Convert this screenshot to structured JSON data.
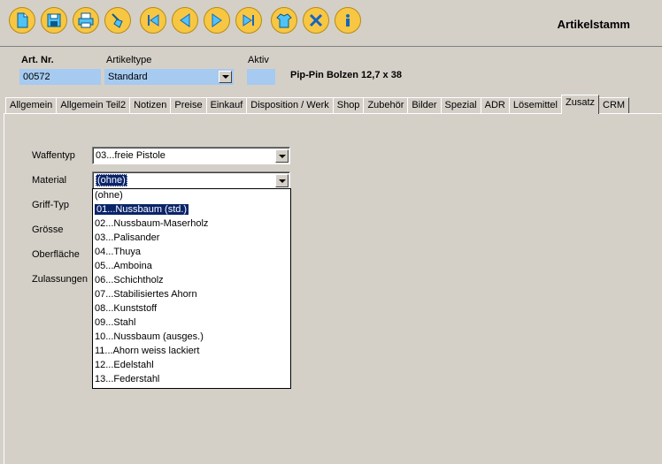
{
  "window": {
    "title": "Artikelstamm"
  },
  "toolbar": {
    "buttons": [
      {
        "icon": "new-document-icon"
      },
      {
        "icon": "save-disk-icon"
      },
      {
        "icon": "printer-icon"
      },
      {
        "icon": "broom-icon"
      },
      {
        "icon": "first-record-icon"
      },
      {
        "icon": "previous-record-icon"
      },
      {
        "icon": "next-record-icon"
      },
      {
        "icon": "last-record-icon"
      },
      {
        "icon": "shirt-icon"
      },
      {
        "icon": "close-x-icon"
      },
      {
        "icon": "info-icon"
      }
    ]
  },
  "header": {
    "art_nr_label": "Art. Nr.",
    "art_nr_value": "00572",
    "artikeltype_label": "Artikeltype",
    "artikeltype_value": "Standard",
    "aktiv_label": "Aktiv",
    "aktiv_value": "",
    "description": "Pip-Pin Bolzen 12,7 x 38"
  },
  "tabs": [
    {
      "label": "Allgemein"
    },
    {
      "label": "Allgemein Teil2"
    },
    {
      "label": "Notizen"
    },
    {
      "label": "Preise"
    },
    {
      "label": "Einkauf"
    },
    {
      "label": "Disposition / Werk"
    },
    {
      "label": "Shop"
    },
    {
      "label": "Zubehör"
    },
    {
      "label": "Bilder"
    },
    {
      "label": "Spezial"
    },
    {
      "label": "ADR"
    },
    {
      "label": "Lösemittel"
    },
    {
      "label": "Zusatz",
      "active": true
    },
    {
      "label": "CRM"
    }
  ],
  "form": {
    "waffentyp_label": "Waffentyp",
    "waffentyp_value": "03...freie Pistole",
    "material_label": "Material",
    "material_value": "(ohne)",
    "grifftyp_label": "Griff-Typ",
    "groesse_label": "Grösse",
    "oberflaeche_label": "Oberfläche",
    "zulassungen_label": "Zulassungen"
  },
  "material_options": [
    "(ohne)",
    "01...Nussbaum (std.)",
    "02...Nussbaum-Maserholz",
    "03...Palisander",
    "04...Thuya",
    "05...Amboina",
    "06...Schichtholz",
    "07...Stabilisiertes Ahorn",
    "08...Kunststoff",
    "09...Stahl",
    "10...Nussbaum (ausges.)",
    "11...Ahorn weiss lackiert",
    "12...Edelstahl",
    "13...Federstahl"
  ],
  "material_highlighted_index": 1,
  "colors": {
    "accent_button": "#f7c744",
    "field_blue": "#a6caf0",
    "selection": "#0a246a"
  }
}
